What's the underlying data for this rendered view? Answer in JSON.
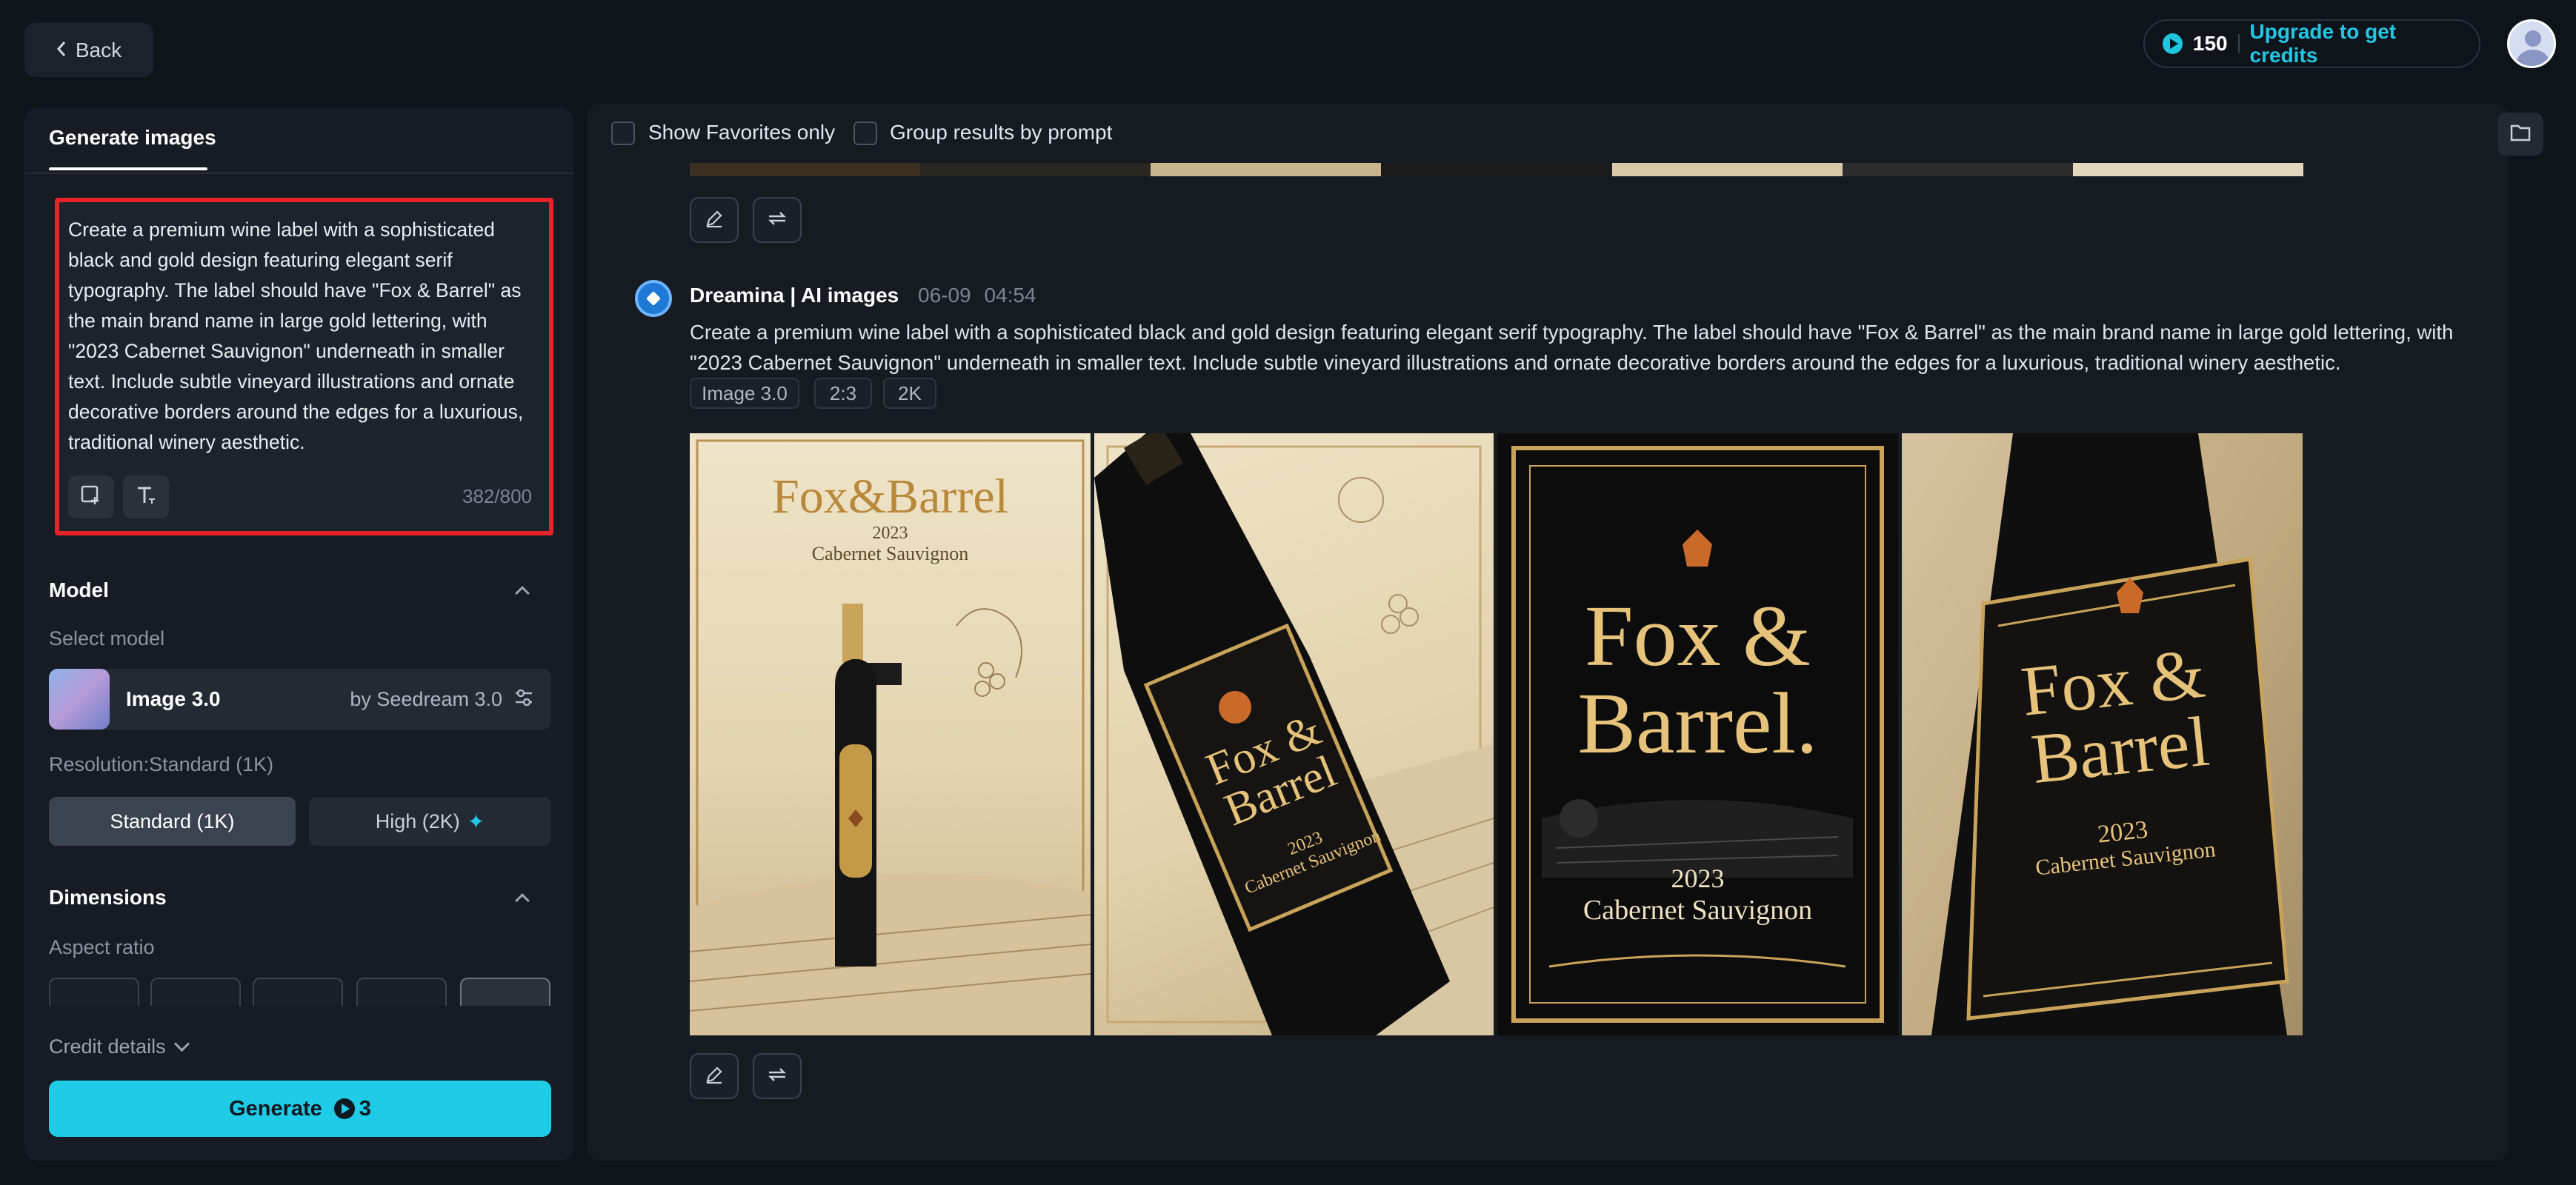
{
  "header": {
    "back_label": "Back",
    "credits": "150",
    "upgrade_label": "Upgrade to get credits"
  },
  "left_panel": {
    "tab_title": "Generate images",
    "prompt": "Create a premium wine label with a sophisticated black and gold design featuring elegant serif typography. The label should have \"Fox & Barrel\" as the main brand name in large gold lettering, with \"2023 Cabernet Sauvignon\" underneath in smaller text. Include subtle vineyard illustrations and ornate decorative borders around the edges for a luxurious, traditional winery aesthetic.",
    "char_count": "382/800",
    "model_section": "Model",
    "select_model_label": "Select model",
    "model_name": "Image 3.0",
    "model_by": "by Seedream 3.0",
    "resolution_label": "Resolution:Standard (1K)",
    "res_standard": "Standard (1K)",
    "res_high": "High (2K)",
    "dimensions_section": "Dimensions",
    "aspect_ratio_label": "Aspect ratio",
    "credit_details": "Credit details",
    "generate_label": "Generate",
    "generate_cost": "3"
  },
  "results": {
    "show_favorites_label": "Show Favorites only",
    "group_by_prompt_label": "Group results by prompt",
    "author": "Dreamina | AI images",
    "date": "06-09",
    "time": "04:54",
    "prompt": "Create a premium wine label with a sophisticated black and gold design featuring elegant serif typography. The label should have \"Fox & Barrel\" as the main brand name in large gold lettering, with \"2023 Cabernet Sauvignon\" underneath in smaller text. Include subtle vineyard illustrations and ornate decorative borders around the edges for a luxurious, traditional winery aesthetic.",
    "tags": [
      "Image 3.0",
      "2:3",
      "2K"
    ],
    "image_text": {
      "brand_a": "Fox&Barrel",
      "year": "2023",
      "varietal": "Cabernet Sauvignon",
      "brand_line1": "Fox &",
      "brand_line2": "Barrel",
      "brand_line2_dot": "Barrel."
    }
  },
  "colors": {
    "accent": "#1fcbe6",
    "prompt_highlight": "#e8232a",
    "gold": "#e6c27a"
  }
}
